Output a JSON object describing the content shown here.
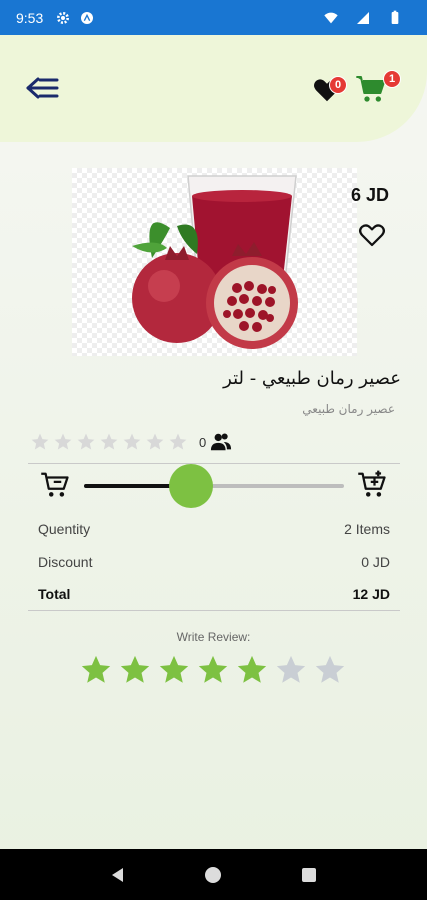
{
  "status_bar": {
    "time": "9:53"
  },
  "header": {
    "favorites_count": "0",
    "cart_count": "1"
  },
  "product": {
    "price": "6 JD",
    "title": "عصير رمان طبيعي - لتر",
    "subtitle": "عصير رمان طبيعي",
    "rating_value": 0,
    "rating_count": "0",
    "quantity_fraction": 0.41
  },
  "summary": {
    "quantity_label": "Quentity",
    "quantity_value": "2 Items",
    "discount_label": "Discount",
    "discount_value": "0 JD",
    "total_label": "Total",
    "total_value": "12 JD"
  },
  "review": {
    "label": "Write Review:",
    "selected_stars": 5,
    "max_stars": 7
  },
  "colors": {
    "status_bar": "#1976d2",
    "header_bg": "#eef6d9",
    "accent_green": "#7dc142",
    "cart_green": "#2e8b2e",
    "badge_red": "#e53935",
    "nav_blue": "#1a2a6c"
  }
}
